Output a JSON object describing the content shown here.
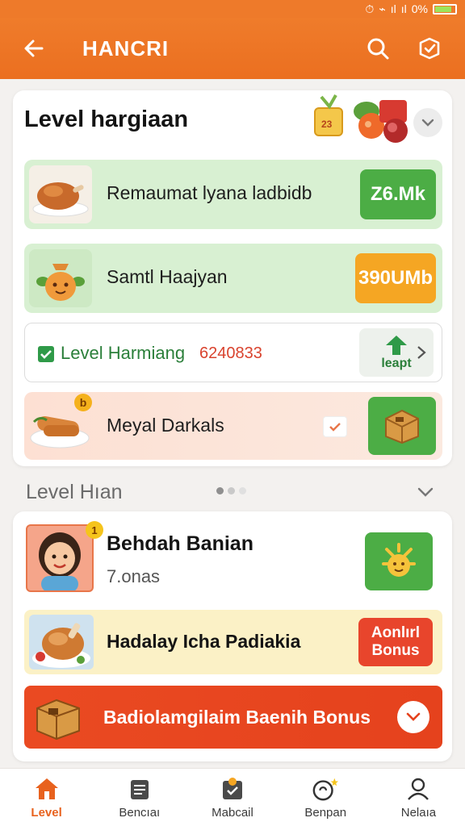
{
  "status_bar": {
    "battery_text": "0%"
  },
  "app_bar": {
    "title": "HANCRI"
  },
  "level_card": {
    "title": "Level hargiaan",
    "rows": [
      {
        "label": "Remaumat lyana ladbidb",
        "value": "Z6.Mk"
      },
      {
        "label": "Samtl Haajyan",
        "value": "390UMb"
      },
      {
        "label": "Level Harmiang",
        "value": "6240833",
        "side_label": "leapt"
      },
      {
        "label": "Meyal Darkals",
        "badge": "b"
      }
    ],
    "gift_badge": "23"
  },
  "section": {
    "title": "Level Hıan"
  },
  "rewards_card": {
    "rows": [
      {
        "title": "Behdah Banian",
        "subtitle": "7.onas",
        "badge": "1"
      },
      {
        "title": "Hadalay Icha Padiakia",
        "button": "Aonlırl Bonus"
      }
    ],
    "cta": {
      "label": "Badiolamgilaim Baenih Bonus"
    }
  },
  "bottom_nav": {
    "items": [
      {
        "label": "Level",
        "active": true
      },
      {
        "label": "Bencıaı"
      },
      {
        "label": "Mabcail"
      },
      {
        "label": "Benpan"
      },
      {
        "label": "Nelaıa"
      }
    ]
  },
  "colors": {
    "brand_orange": "#ee7a2a",
    "green": "#4cad45",
    "amber": "#f5a623",
    "red": "#e8452c"
  }
}
